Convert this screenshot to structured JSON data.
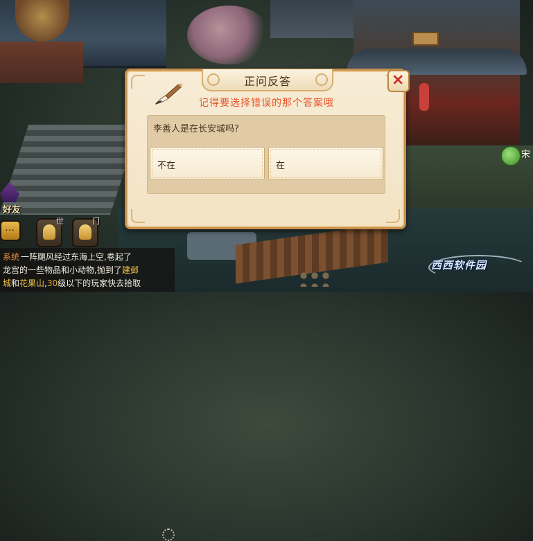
{
  "dialog": {
    "title": "正问反答",
    "hint": "记得要选择错误的那个答案哦",
    "close_symbol": "✕",
    "question": "李善人是在长安城吗?",
    "options": [
      {
        "label": "不在"
      },
      {
        "label": "在"
      }
    ],
    "hint_color": "#e4542a",
    "close_color": "#d42a1c"
  },
  "hud": {
    "friends_label": "好友",
    "world_channel_tag": "世",
    "team_channel_tag": "门",
    "right_label": "宋"
  },
  "chat": {
    "lines": [
      [
        {
          "text": "系统",
          "style": "sys"
        },
        {
          "text": "一阵飓风经过东海上空,卷起了"
        }
      ],
      [
        {
          "text": "龙宫的一些物品和小动物,抛到了"
        },
        {
          "text": "建邺",
          "style": "hl"
        }
      ],
      [
        {
          "text": "城",
          "style": "hl"
        },
        {
          "text": "和"
        },
        {
          "text": "花果山",
          "style": "hl"
        },
        {
          "text": ","
        },
        {
          "text": "30",
          "style": "hl2"
        },
        {
          "text": "级以下的玩家快去拾取"
        }
      ]
    ]
  },
  "watermark": "西西软件园",
  "icons": [
    "brush-icon",
    "close-icon",
    "chat-icon",
    "mic-world-icon",
    "mic-team-icon",
    "settings-icon",
    "jade-orb-icon"
  ]
}
